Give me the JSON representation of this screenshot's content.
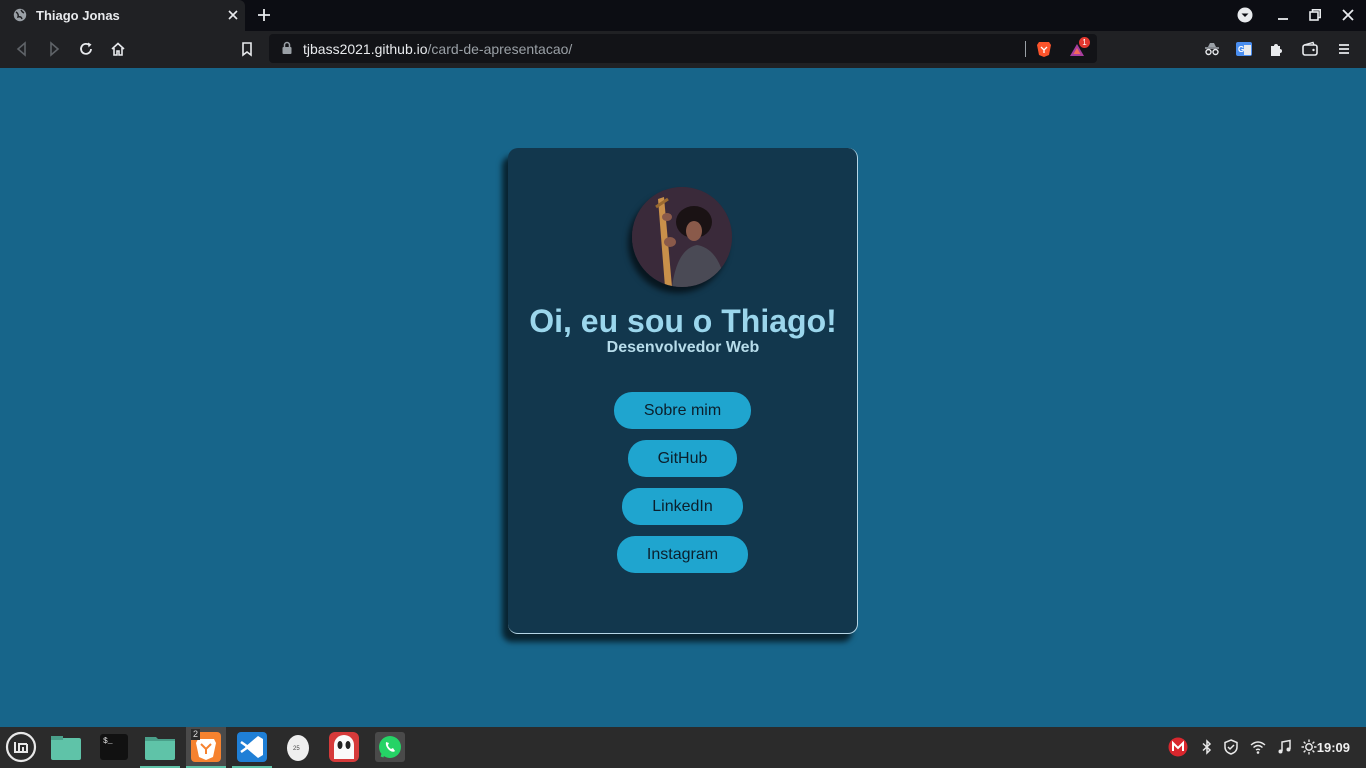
{
  "browser": {
    "tab_title": "Thiago Jonas",
    "url_host": "tjbass2021.github.io",
    "url_path": "/card-de-apresentacao/",
    "rewards_count": "1",
    "icons": [
      "globe-icon",
      "close-icon",
      "plus-icon",
      "dropdown-icon",
      "minimize-icon",
      "maximize-icon",
      "close-icon",
      "back-icon",
      "forward-icon",
      "reload-icon",
      "home-icon",
      "bookmark-icon",
      "lock-icon",
      "brave-shields-icon",
      "brave-rewards-icon",
      "incognito-icon",
      "translate-icon",
      "extensions-icon",
      "wallet-icon",
      "menu-icon"
    ]
  },
  "card": {
    "heading": "Oi, eu sou o Thiago!",
    "subheading": "Desenvolvedor Web",
    "buttons": [
      {
        "label": "Sobre mim"
      },
      {
        "label": "GitHub"
      },
      {
        "label": "LinkedIn"
      },
      {
        "label": "Instagram"
      }
    ],
    "colors": {
      "background": "#17658a",
      "card": "#12374d",
      "button": "#1fa5cf",
      "heading": "#9bd6ec"
    }
  },
  "taskbar": {
    "workspace_badge": "2",
    "clock": "19:09",
    "apps": [
      "mint-menu-icon",
      "files-icon",
      "terminal-icon",
      "folder-icon",
      "brave-browser-icon",
      "vscode-icon",
      "egg-app-icon",
      "ghost-app-icon",
      "whatsapp-icon"
    ],
    "tray": [
      "mega-icon",
      "bluetooth-icon",
      "shield-icon",
      "wifi-icon",
      "music-icon",
      "brightness-icon"
    ]
  }
}
